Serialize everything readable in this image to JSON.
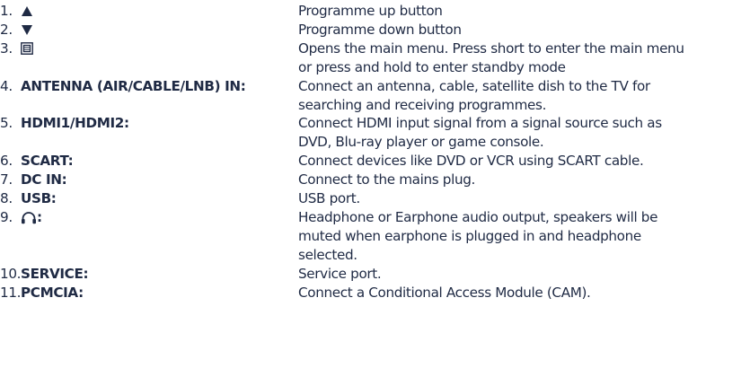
{
  "items": [
    {
      "number": "1.",
      "label": "",
      "icon": "triangle-up-icon",
      "lines": [
        "Programme up button"
      ]
    },
    {
      "number": "2.",
      "label": "",
      "icon": "triangle-down-icon",
      "lines": [
        "Programme down button"
      ]
    },
    {
      "number": "3.",
      "label": "",
      "icon": "menu-square-icon",
      "lines": [
        "Opens the main menu. Press short to enter the main menu",
        "or press and hold to enter standby mode"
      ]
    },
    {
      "number": "4.",
      "label": "ANTENNA (AIR/CABLE/LNB) IN:",
      "lines": [
        "Connect an antenna, cable, satellite dish to the TV for",
        "searching and receiving programmes."
      ]
    },
    {
      "number": "5.",
      "label": "HDMI1/HDMI2:",
      "lines": [
        "Connect HDMI input signal from a signal source such as",
        "DVD, Blu-ray player or game console."
      ]
    },
    {
      "number": "6.",
      "label": "SCART:",
      "lines": [
        "Connect devices like DVD or VCR using SCART cable."
      ]
    },
    {
      "number": "7.",
      "label": "DC IN:",
      "lines": [
        "Connect to the mains plug."
      ]
    },
    {
      "number": "8.",
      "label": "USB:",
      "lines": [
        "USB port."
      ]
    },
    {
      "number": "9.",
      "label": ":",
      "icon": "headphone-icon",
      "lines": [
        "Headphone or Earphone audio output, speakers will be",
        "muted when earphone is plugged in and headphone",
        "selected."
      ]
    },
    {
      "number": "10.",
      "label": "SERVICE:",
      "lines": [
        "Service port."
      ]
    },
    {
      "number": "11.",
      "label": "PCMCIA:",
      "lines": [
        "Connect a Conditional Access Module (CAM)."
      ]
    }
  ]
}
